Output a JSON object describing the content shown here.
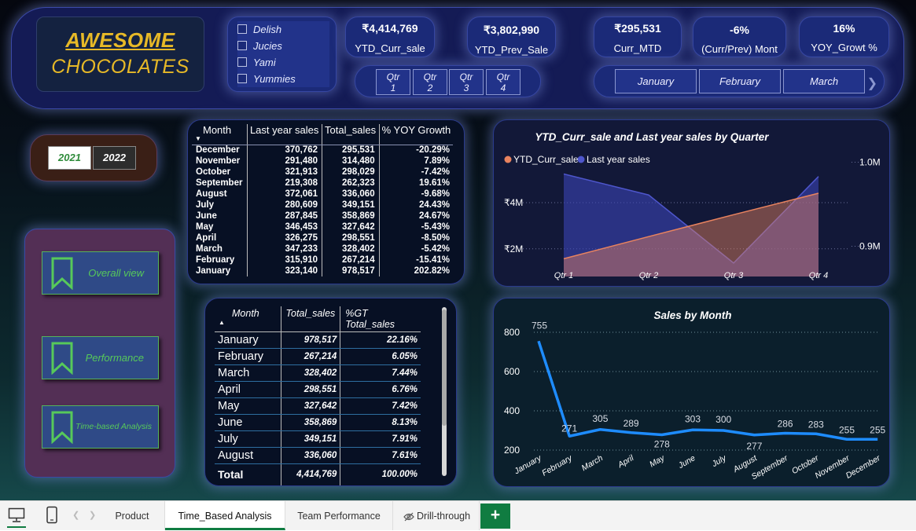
{
  "logo": {
    "line1": "AWESOME",
    "line2": "CHOCOLATES"
  },
  "product_slicer": [
    "Delish",
    "Jucies",
    "Yami",
    "Yummies"
  ],
  "kpis": [
    {
      "value": "₹4,414,769",
      "label": "YTD_Curr_sale"
    },
    {
      "value": "₹3,802,990",
      "label": "YTD_Prev_Sale"
    },
    {
      "value": "₹295,531",
      "label": "Curr_MTD"
    },
    {
      "value": "-6%",
      "label": "(Curr/Prev) Mont"
    },
    {
      "value": "16%",
      "label": "YOY_Growt %"
    }
  ],
  "quarters": [
    [
      "Qtr",
      "1"
    ],
    [
      "Qtr",
      "2"
    ],
    [
      "Qtr",
      "3"
    ],
    [
      "Qtr",
      "4"
    ]
  ],
  "months_slicer": [
    "January",
    "February",
    "March"
  ],
  "years": {
    "y1": "2021",
    "y2": "2022"
  },
  "nav": {
    "overall": "Overall view",
    "performance": "Performance",
    "time": "Time-based Analysis"
  },
  "yoy_table": {
    "headers": [
      "Month",
      "Last year sales",
      "Total_sales",
      "% YOY Growth"
    ],
    "rows": [
      [
        "December",
        "370,762",
        "295,531",
        "-20.29%"
      ],
      [
        "November",
        "291,480",
        "314,480",
        "7.89%"
      ],
      [
        "October",
        "321,913",
        "298,029",
        "-7.42%"
      ],
      [
        "September",
        "219,308",
        "262,323",
        "19.61%"
      ],
      [
        "August",
        "372,061",
        "336,060",
        "-9.68%"
      ],
      [
        "July",
        "280,609",
        "349,151",
        "24.43%"
      ],
      [
        "June",
        "287,845",
        "358,869",
        "24.67%"
      ],
      [
        "May",
        "346,453",
        "327,642",
        "-5.43%"
      ],
      [
        "April",
        "326,275",
        "298,551",
        "-8.50%"
      ],
      [
        "March",
        "347,233",
        "328,402",
        "-5.42%"
      ],
      [
        "February",
        "315,910",
        "267,214",
        "-15.41%"
      ],
      [
        "January",
        "323,140",
        "978,517",
        "202.82%"
      ]
    ]
  },
  "gt_table": {
    "headers": [
      "Month",
      "Total_sales",
      "%GT Total_sales"
    ],
    "rows": [
      [
        "January",
        "978,517",
        "22.16%"
      ],
      [
        "February",
        "267,214",
        "6.05%"
      ],
      [
        "March",
        "328,402",
        "7.44%"
      ],
      [
        "April",
        "298,551",
        "6.76%"
      ],
      [
        "May",
        "327,642",
        "7.42%"
      ],
      [
        "June",
        "358,869",
        "8.13%"
      ],
      [
        "July",
        "349,151",
        "7.91%"
      ],
      [
        "August",
        "336,060",
        "7.61%"
      ]
    ],
    "total": [
      "Total",
      "4,414,769",
      "100.00%"
    ]
  },
  "chart_data": [
    {
      "type": "area",
      "title": "YTD_Curr_sale and Last year sales by Quarter",
      "categories": [
        "Qtr 1",
        "Qtr 2",
        "Qtr 3",
        "Qtr 4"
      ],
      "series": [
        {
          "name": "YTD_Curr_sale",
          "axis": "left",
          "color": "#e9835f",
          "values": [
            1.57,
            2.53,
            3.48,
            4.41
          ]
        },
        {
          "name": "Last year sales",
          "axis": "right",
          "color": "#3b44b6",
          "values": [
            986000,
            961000,
            880000,
            983000
          ]
        }
      ],
      "left_axis": {
        "ticks": [
          "₹2M",
          "₹4M"
        ],
        "range": [
          0.8,
          5.5
        ],
        "unit": "M"
      },
      "right_axis": {
        "ticks": [
          "0.9M",
          "1.0M"
        ],
        "range": [
          0.864,
          0.993
        ],
        "unit": "M"
      },
      "legend": "top-left",
      "grid": true
    },
    {
      "type": "line",
      "title": "Sales by Month",
      "categories": [
        "January",
        "February",
        "March",
        "April",
        "May",
        "June",
        "July",
        "August",
        "September",
        "October",
        "November",
        "December"
      ],
      "series": [
        {
          "name": "Total_sales",
          "color": "#1e8cff",
          "values": [
            755,
            271,
            305,
            289,
            278,
            303,
            300,
            277,
            286,
            283,
            255,
            255
          ]
        }
      ],
      "data_labels": [
        "755",
        "271",
        "305",
        "289",
        "278",
        "303",
        "300",
        "277",
        "286",
        "283",
        "255",
        "255"
      ],
      "y_ticks": [
        "200",
        "400",
        "600",
        "800"
      ],
      "ylim": [
        200,
        800
      ],
      "grid": true
    }
  ],
  "tabs": [
    "Product",
    "Time_Based Analysis",
    "Team Performance",
    "Drill-through"
  ],
  "tab_add": "+"
}
